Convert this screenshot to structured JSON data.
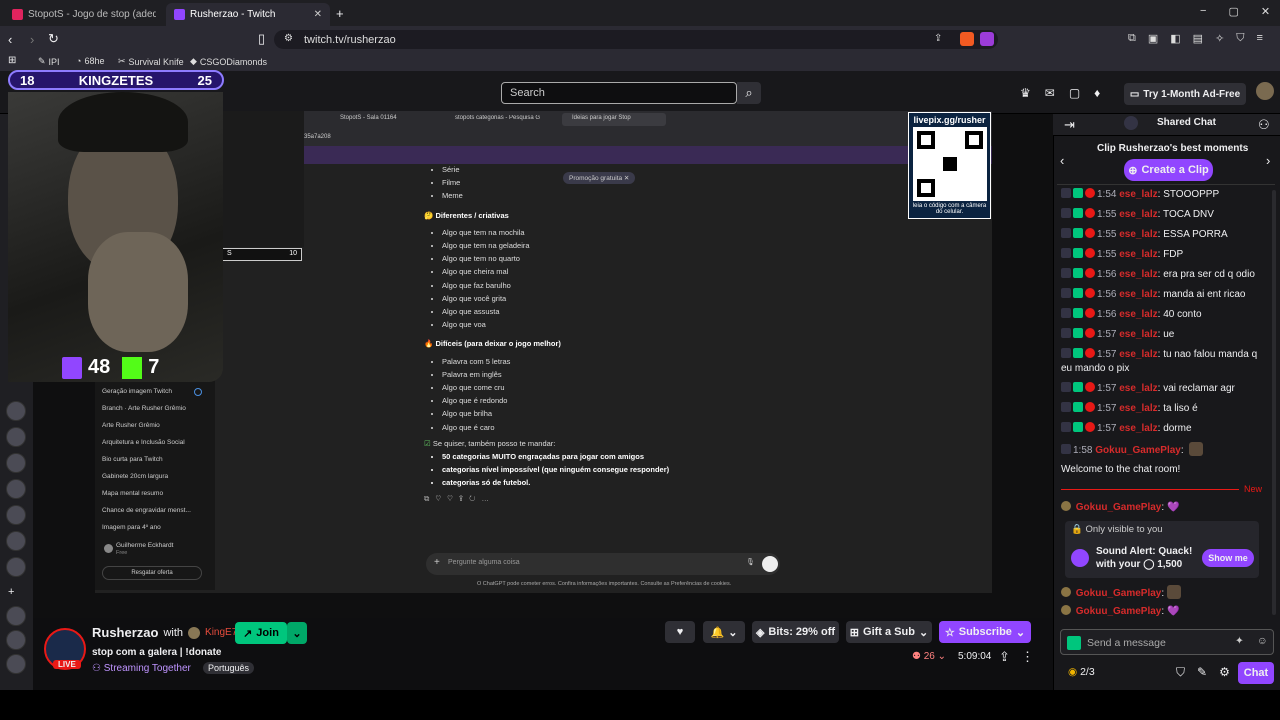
{
  "browser": {
    "tabs": [
      {
        "label": "StopotS - Jogo de stop (adedanha o"
      },
      {
        "label": "Rusherzao - Twitch"
      }
    ],
    "url": "twitch.tv/rusherzao",
    "bookmarks": [
      "IPI",
      "68he",
      "Survival Knife",
      "CSGODiamonds"
    ],
    "window_controls": [
      "−",
      "▢",
      "✕"
    ]
  },
  "twitch_header": {
    "search_placeholder": "Search",
    "ad_free": "Try 1-Month Ad-Free"
  },
  "overlay": {
    "score_left": "18",
    "score_name": "KINGZETES",
    "score_right": "25",
    "twitch_count": "48",
    "kick_count": "7",
    "qr_title": "livepix.gg/rusher",
    "qr_caption": "leia o código com a câmera do celular."
  },
  "inner_browser": {
    "tabs": [
      "StopotS - Sala 01164",
      "stopots categorias - Pesquisa G",
      "Ideias para jogar Stop"
    ],
    "url": "35a7a208",
    "promo": "Promoção gratuita",
    "section0": [
      "Série",
      "Filme",
      "Meme"
    ],
    "section1_title": "Diferentes / criativas",
    "section1": [
      "Algo que tem na mochila",
      "Algo que tem na geladeira",
      "Algo que tem no quarto",
      "Algo que cheira mal",
      "Algo que faz barulho",
      "Algo que você grita",
      "Algo que assusta",
      "Algo que voa"
    ],
    "section2_title": "Difíceis (para deixar o jogo melhor)",
    "section2": [
      "Palavra com 5 letras",
      "Palavra em inglês",
      "Algo que come cru",
      "Algo que é redondo",
      "Algo que brilha",
      "Algo que é caro"
    ],
    "offer_line": "Se quiser, também posso te mandar:",
    "offers": [
      "50 categorias MUITO engraçadas para jogar com amigos",
      "categorias nível impossível (que ninguém consegue responder)",
      "categorias só de futebol."
    ],
    "input_placeholder": "Pergunte alguma coisa",
    "disclaimer": "O ChatGPT pode cometer erros. Confira informações importantes. Consulte as Preferências de cookies.",
    "sidebar": [
      "Geração imagem Twitch",
      "Branch · Arte Rusher Grêmio",
      "Arte Rusher Grêmio",
      "Arquitetura e Inclusão Social",
      "Bio curta para Twitch",
      "Gabinete 20cm largura",
      "Mapa mental resumo",
      "Chance de engravidar menst...",
      "Imagem para 4º ano"
    ],
    "user_name": "Guilherme Eckhardt",
    "user_plan": "Free",
    "redeem": "Resgatar oferta",
    "webcam2_label": "S",
    "webcam2_value": "10"
  },
  "stream_info": {
    "streamer": "Rusherzao",
    "with": "with",
    "collab": "KingE7s",
    "join": "Join",
    "title": "stop com a galera | !donate",
    "category": "Streaming Together",
    "language": "Português",
    "live": "LIVE",
    "bits": "Bits: 29% off",
    "gift": "Gift a Sub",
    "subscribe": "Subscribe",
    "viewers": "26",
    "uptime": "5:09:04"
  },
  "chat": {
    "header": "Shared Chat",
    "best_moments": "Clip Rusherzao's best moments",
    "create_clip": "Create a Clip",
    "messages": [
      {
        "time": "1:54",
        "user": "ese_lalz",
        "text": "STOOOPPP"
      },
      {
        "time": "1:55",
        "user": "ese_lalz",
        "text": "TOCA DNV"
      },
      {
        "time": "1:55",
        "user": "ese_lalz",
        "text": "ESSA PORRA"
      },
      {
        "time": "1:55",
        "user": "ese_lalz",
        "text": "FDP"
      },
      {
        "time": "1:56",
        "user": "ese_lalz",
        "text": "era pra ser cd q odio"
      },
      {
        "time": "1:56",
        "user": "ese_lalz",
        "text": "manda ai ent ricao"
      },
      {
        "time": "1:56",
        "user": "ese_lalz",
        "text": "40 conto"
      },
      {
        "time": "1:57",
        "user": "ese_lalz",
        "text": "ue"
      },
      {
        "time": "1:57",
        "user": "ese_lalz",
        "text": "tu nao falou manda q eu mando o pix"
      },
      {
        "time": "1:57",
        "user": "ese_lalz",
        "text": "vai reclamar agr"
      },
      {
        "time": "1:57",
        "user": "ese_lalz",
        "text": "ta liso é"
      },
      {
        "time": "1:57",
        "user": "ese_lalz",
        "text": "dorme"
      },
      {
        "time": "1:58",
        "user": "Gokuu_GamePlay",
        "text": ""
      }
    ],
    "welcome": "Welcome to the chat room!",
    "new_label": "New",
    "after": [
      {
        "user": "Gokuu_GamePlay",
        "text": "💜"
      }
    ],
    "only_visible": "Only visible to you",
    "sound_alert_1": "Sound Alert: Quack!",
    "sound_alert_2": "with your",
    "sound_alert_cost": "1,500",
    "show_me": "Show me",
    "after2": [
      {
        "user": "Gokuu_GamePlay",
        "text": ""
      },
      {
        "user": "Gokuu_GamePlay",
        "text": "💜"
      }
    ],
    "send_placeholder": "Send a message",
    "points": "2/3",
    "chat_button": "Chat"
  }
}
